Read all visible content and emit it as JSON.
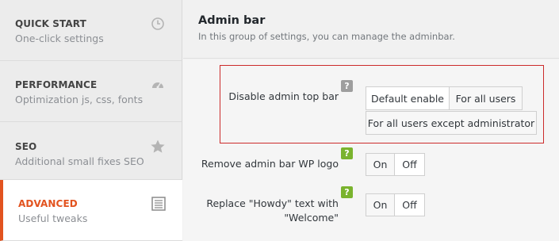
{
  "sidebar": {
    "items": [
      {
        "title": "QUICK START",
        "subtitle": "One-click settings",
        "icon": "clock-icon"
      },
      {
        "title": "PERFORMANCE",
        "subtitle": "Optimization js, css, fonts",
        "icon": "speedometer-icon"
      },
      {
        "title": "SEO",
        "subtitle": "Additional small fixes SEO",
        "icon": "star-icon"
      },
      {
        "title": "ADVANCED",
        "subtitle": "Useful tweaks",
        "icon": "list-icon",
        "active": true
      }
    ],
    "active_color": "#e2531f"
  },
  "header": {
    "title": "Admin bar",
    "description": "In this group of settings, you can manage the adminbar."
  },
  "settings": {
    "disable_top_bar": {
      "label": "Disable admin top bar",
      "help": "?",
      "options": [
        "Default enable",
        "For all users",
        "For all users except administrator"
      ],
      "selected": "Default enable"
    },
    "remove_wp_logo": {
      "label": "Remove admin bar WP logo",
      "help": "?",
      "on_label": "On",
      "off_label": "Off"
    },
    "replace_howdy": {
      "label_line1": "Replace \"Howdy\" text with",
      "label_line2": "\"Welcome\"",
      "help": "?",
      "on_label": "On",
      "off_label": "Off"
    }
  },
  "colors": {
    "highlight_border": "#cc2b2b",
    "help_gray": "#9e9e9e",
    "help_green": "#7ab32e"
  }
}
